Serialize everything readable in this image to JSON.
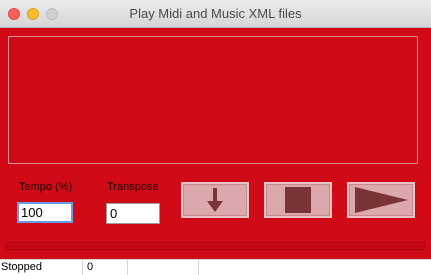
{
  "window": {
    "title": "Play Midi and Music XML files"
  },
  "controls": {
    "tempo_label": "Tempo (%)",
    "tempo_value": "100",
    "transpose_label": "Transpose",
    "transpose_value": "0"
  },
  "buttons": [
    {
      "name": "load-button",
      "icon": "down-arrow-icon"
    },
    {
      "name": "stop-button",
      "icon": "stop-icon"
    },
    {
      "name": "play-button",
      "icon": "play-icon"
    }
  ],
  "progress": {
    "fraction": 0
  },
  "status": {
    "state": "Stopped",
    "position": "0"
  },
  "colors": {
    "background": "#d10a17",
    "button": "#dba8ab",
    "icon": "#7a3438"
  }
}
